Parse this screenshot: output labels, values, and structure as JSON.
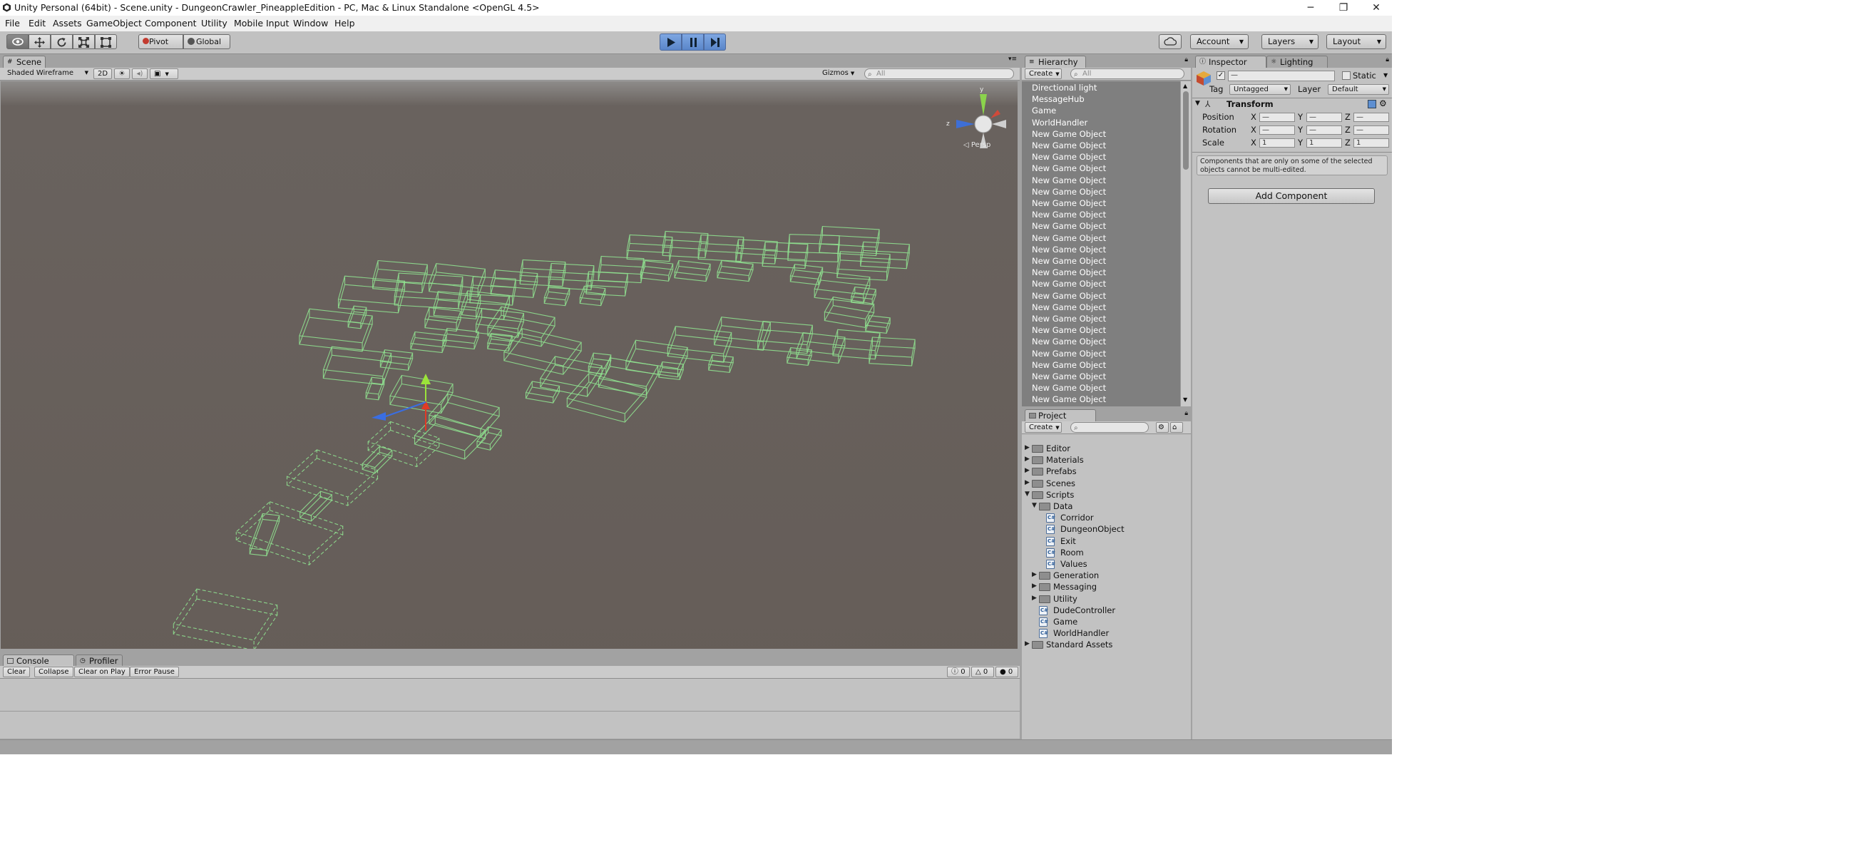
{
  "window": {
    "title": "Unity Personal (64bit) - Scene.unity - DungeonCrawler_PineappleEdition - PC, Mac & Linux Standalone <OpenGL 4.5>",
    "controls": [
      "─",
      "❐",
      "✕"
    ]
  },
  "menu": [
    "File",
    "Edit",
    "Assets",
    "GameObject",
    "Component",
    "Utility",
    "Mobile Input",
    "Window",
    "Help"
  ],
  "toolbar": {
    "tools": [
      "hand-tool",
      "move-tool",
      "rotate-tool",
      "scale-tool",
      "rect-tool"
    ],
    "pivot": "Pivot",
    "global": "Global",
    "account": "Account",
    "layers": "Layers",
    "layout": "Layout",
    "play_state": "playing-paused"
  },
  "scene": {
    "tab": "Scene",
    "shading": "Shaded Wireframe",
    "mode_2d": "2D",
    "gizmos": "Gizmos",
    "search_placeholder": "All",
    "projection": "Persp"
  },
  "hierarchy": {
    "tab": "Hierarchy",
    "create": "Create",
    "search_placeholder": "All",
    "items": [
      "Directional light",
      "MessageHub",
      "Game",
      "WorldHandler",
      "New Game Object",
      "New Game Object",
      "New Game Object",
      "New Game Object",
      "New Game Object",
      "New Game Object",
      "New Game Object",
      "New Game Object",
      "New Game Object",
      "New Game Object",
      "New Game Object",
      "New Game Object",
      "New Game Object",
      "New Game Object",
      "New Game Object",
      "New Game Object",
      "New Game Object",
      "New Game Object",
      "New Game Object",
      "New Game Object",
      "New Game Object",
      "New Game Object",
      "New Game Object",
      "New Game Object"
    ]
  },
  "project": {
    "tab": "Project",
    "create": "Create",
    "items": [
      {
        "label": "Editor",
        "kind": "folder",
        "depth": 0,
        "arrow": "▶"
      },
      {
        "label": "Materials",
        "kind": "folder",
        "depth": 0,
        "arrow": "▶"
      },
      {
        "label": "Prefabs",
        "kind": "folder",
        "depth": 0,
        "arrow": "▶"
      },
      {
        "label": "Scenes",
        "kind": "folder",
        "depth": 0,
        "arrow": "▶"
      },
      {
        "label": "Scripts",
        "kind": "folder",
        "depth": 0,
        "arrow": "▼"
      },
      {
        "label": "Data",
        "kind": "folder",
        "depth": 1,
        "arrow": "▼"
      },
      {
        "label": "Corridor",
        "kind": "script",
        "depth": 2,
        "arrow": ""
      },
      {
        "label": "DungeonObject",
        "kind": "script",
        "depth": 2,
        "arrow": ""
      },
      {
        "label": "Exit",
        "kind": "script",
        "depth": 2,
        "arrow": ""
      },
      {
        "label": "Room",
        "kind": "script",
        "depth": 2,
        "arrow": ""
      },
      {
        "label": "Values",
        "kind": "script",
        "depth": 2,
        "arrow": ""
      },
      {
        "label": "Generation",
        "kind": "folder",
        "depth": 1,
        "arrow": "▶"
      },
      {
        "label": "Messaging",
        "kind": "folder",
        "depth": 1,
        "arrow": "▶"
      },
      {
        "label": "Utility",
        "kind": "folder",
        "depth": 1,
        "arrow": "▶"
      },
      {
        "label": "DudeController",
        "kind": "script",
        "depth": 1,
        "arrow": ""
      },
      {
        "label": "Game",
        "kind": "script",
        "depth": 1,
        "arrow": ""
      },
      {
        "label": "WorldHandler",
        "kind": "script",
        "depth": 1,
        "arrow": ""
      },
      {
        "label": "Standard Assets",
        "kind": "folder",
        "depth": 0,
        "arrow": "▶"
      }
    ]
  },
  "inspector": {
    "tab": "Inspector",
    "tab2": "Lighting",
    "name_value": "—",
    "static_label": "Static",
    "tag_label": "Tag",
    "tag_value": "Untagged",
    "layer_label": "Layer",
    "layer_value": "Default",
    "transform": {
      "title": "Transform",
      "position_label": "Position",
      "rotation_label": "Rotation",
      "scale_label": "Scale",
      "x": "X",
      "y": "Y",
      "z": "Z",
      "position": [
        "—",
        "—",
        "—"
      ],
      "rotation": [
        "—",
        "—",
        "—"
      ],
      "scale": [
        "1",
        "1",
        "1"
      ]
    },
    "multi_edit_note": "Components that are only on some of the selected objects cannot be multi-edited.",
    "add_component": "Add Component"
  },
  "console": {
    "tab": "Console",
    "tab2": "Profiler",
    "buttons": [
      "Clear",
      "Collapse",
      "Clear on Play",
      "Error Pause"
    ],
    "info_count": "0",
    "warn_count": "0",
    "error_count": "0"
  },
  "colors": {
    "wireframe": "#8fe08f",
    "play_blue": "#5a86c9",
    "scene_bg": "#655d58",
    "panel_bg": "#c2c2c2"
  }
}
